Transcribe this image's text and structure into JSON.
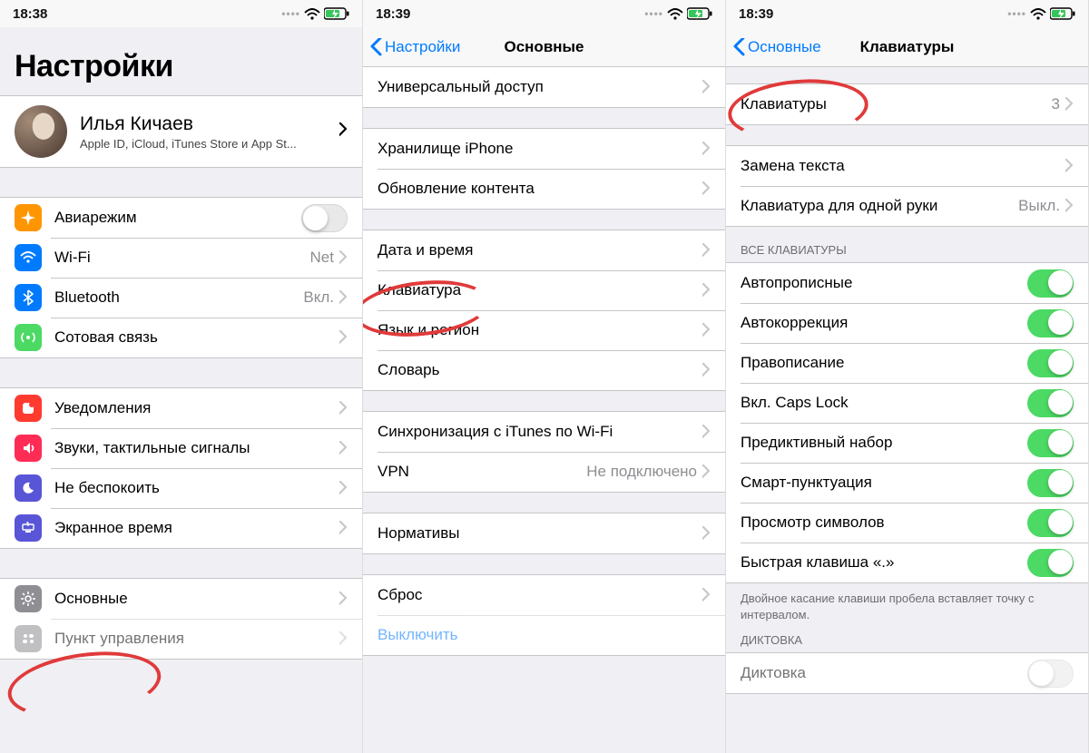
{
  "status": {
    "time1": "18:38",
    "time2": "18:39",
    "time3": "18:39"
  },
  "screen1": {
    "title": "Настройки",
    "profile": {
      "name": "Илья Кичаев",
      "sub": "Apple ID, iCloud, iTunes Store и App St..."
    },
    "rows": {
      "airplane": "Авиарежим",
      "wifi": "Wi-Fi",
      "wifi_val": "Net",
      "bluetooth": "Bluetooth",
      "bluetooth_val": "Вкл.",
      "cellular": "Сотовая связь",
      "notifications": "Уведомления",
      "sounds": "Звуки, тактильные сигналы",
      "dnd": "Не беспокоить",
      "screentime": "Экранное время",
      "general": "Основные",
      "control": "Пункт управления"
    }
  },
  "screen2": {
    "back": "Настройки",
    "title": "Основные",
    "rows": {
      "accessibility": "Универсальный доступ",
      "storage": "Хранилище iPhone",
      "refresh": "Обновление контента",
      "datetime": "Дата и время",
      "keyboard": "Клавиатура",
      "lang": "Язык и регион",
      "dictionary": "Словарь",
      "itunes_wifi": "Синхронизация с iTunes по Wi-Fi",
      "vpn": "VPN",
      "vpn_val": "Не подключено",
      "regulatory": "Нормативы",
      "reset": "Сброс",
      "shutdown": "Выключить"
    }
  },
  "screen3": {
    "back": "Основные",
    "title": "Клавиатуры",
    "rows": {
      "keyboards": "Клавиатуры",
      "keyboards_val": "3",
      "textreplace": "Замена текста",
      "onehand": "Клавиатура для одной руки",
      "onehand_val": "Выкл.",
      "section_all": "ВСЕ КЛАВИАТУРЫ",
      "autocap": "Автопрописные",
      "autocorrect": "Автокоррекция",
      "spell": "Правописание",
      "caps": "Вкл. Caps Lock",
      "predictive": "Предиктивный набор",
      "smart": "Смарт-пунктуация",
      "preview": "Просмотр символов",
      "shortcut": "Быстрая клавиша «.»",
      "footer": "Двойное касание клавиши пробела вставляет точку с интервалом.",
      "section_dict": "ДИКТОВКА",
      "dictation": "Диктовка"
    }
  }
}
